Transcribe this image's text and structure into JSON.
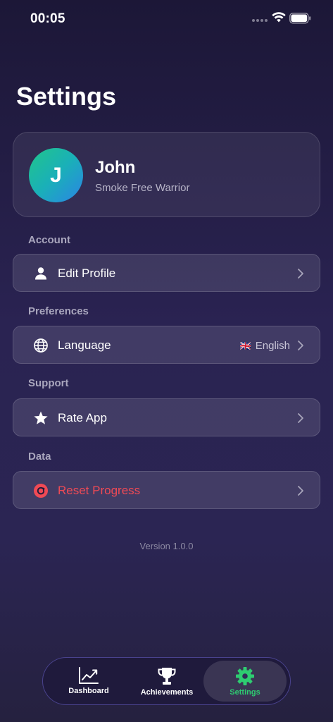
{
  "status_bar": {
    "time": "00:05"
  },
  "page": {
    "title": "Settings"
  },
  "profile": {
    "initial": "J",
    "name": "John",
    "subtitle": "Smoke Free Warrior"
  },
  "sections": {
    "account": {
      "label": "Account",
      "edit_profile": "Edit Profile"
    },
    "preferences": {
      "label": "Preferences",
      "language": "Language",
      "language_value": "English",
      "language_flag": "🇬🇧"
    },
    "support": {
      "label": "Support",
      "rate_app": "Rate App"
    },
    "data": {
      "label": "Data",
      "reset_progress": "Reset Progress"
    }
  },
  "version": "Version 1.0.0",
  "tabs": [
    {
      "label": "Dashboard",
      "icon": "chart-line-icon"
    },
    {
      "label": "Achievements",
      "icon": "trophy-icon"
    },
    {
      "label": "Settings",
      "icon": "gear-icon",
      "active": true
    }
  ],
  "colors": {
    "accent": "#2ecc71",
    "danger": "#f04a55"
  }
}
